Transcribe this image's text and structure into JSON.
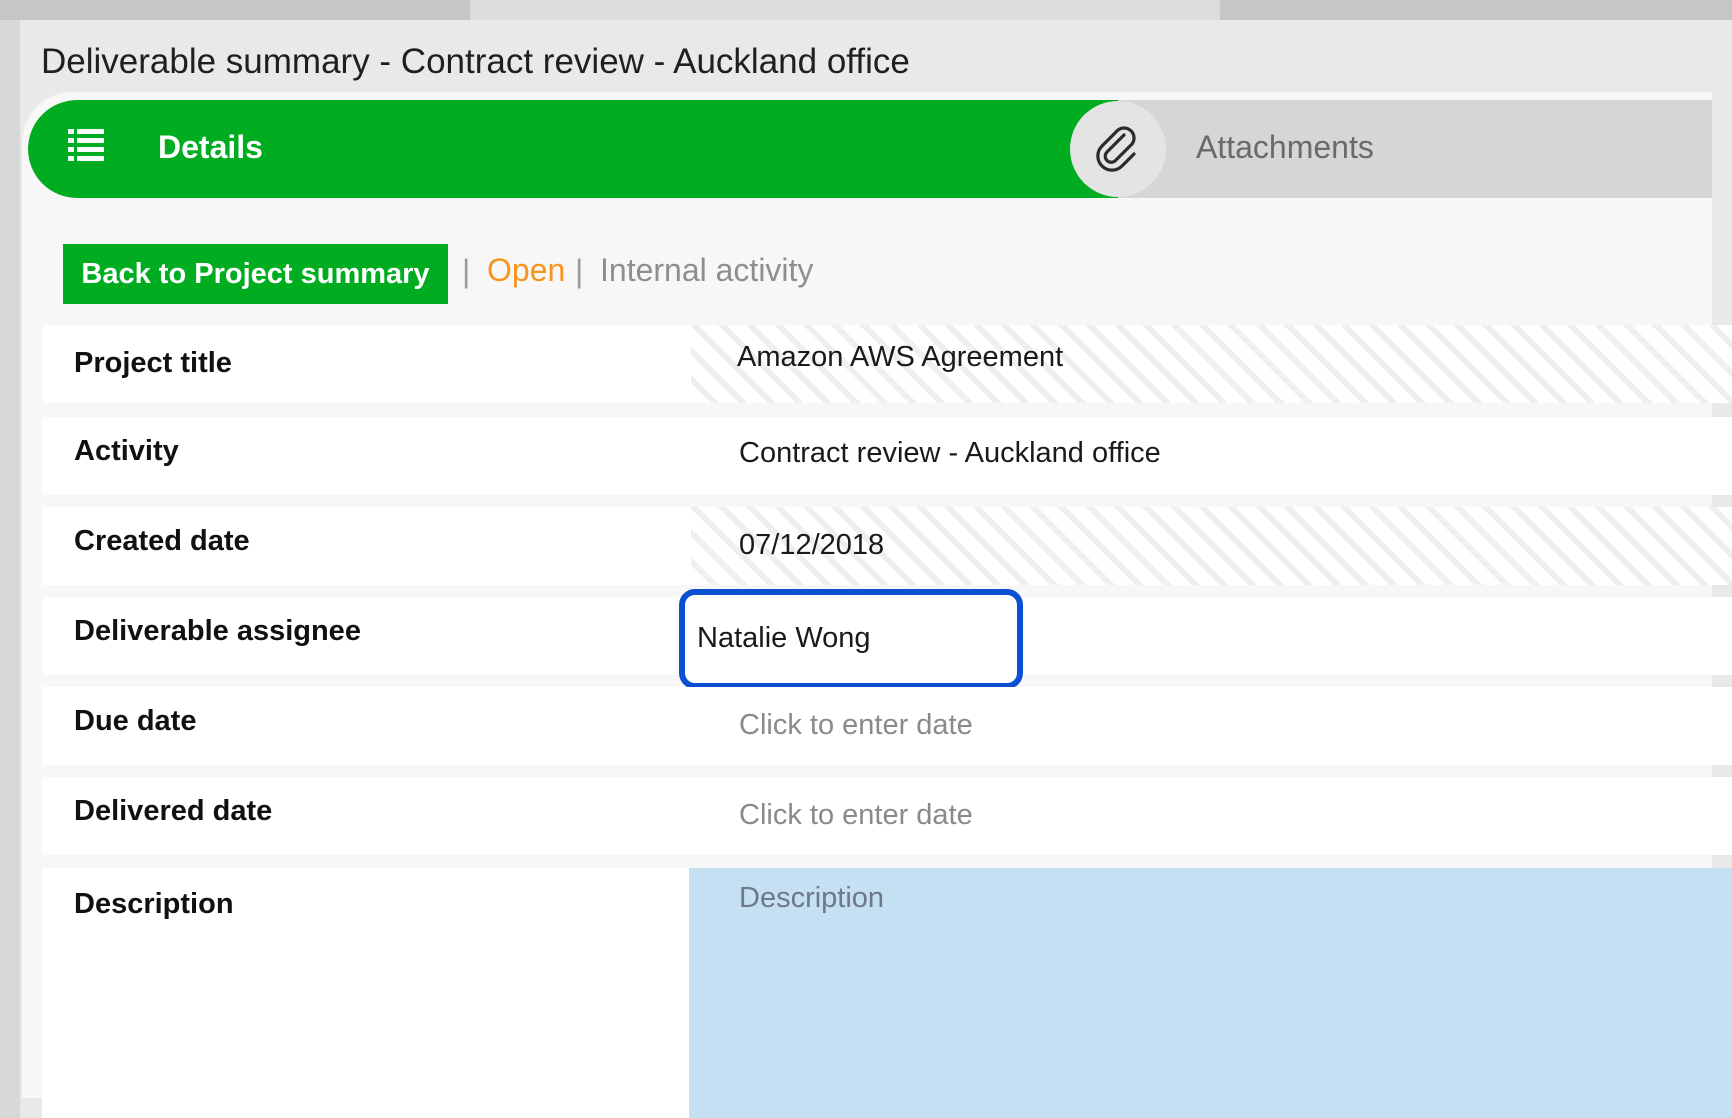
{
  "window": {
    "title": "Deliverable summary - Contract review - Auckland office"
  },
  "tabs": [
    {
      "label": "Details",
      "icon": "list-icon",
      "active": true
    },
    {
      "label": "Attachments",
      "icon": "paperclip-icon",
      "active": false
    }
  ],
  "subheader": {
    "back_button": "Back to Project summary",
    "separator": "|",
    "status": "Open",
    "activity_type": "Internal activity"
  },
  "fields": [
    {
      "label": "Project title",
      "value": "Amazon AWS Agreement"
    },
    {
      "label": "Activity",
      "value": "Contract review - Auckland office"
    },
    {
      "label": "Created date",
      "value": "07/12/2018"
    },
    {
      "label": "Deliverable assignee",
      "value": "Natalie Wong"
    },
    {
      "label": "Due date",
      "value": "Click to enter date"
    },
    {
      "label": "Delivered date",
      "value": "Click to enter date"
    },
    {
      "label": "Description",
      "value": "Description"
    }
  ],
  "colors": {
    "accent_green": "#00ad21",
    "status_orange": "#f7941d",
    "highlight_blue": "#0b4fd2",
    "description_bg": "#c5e0f3"
  }
}
